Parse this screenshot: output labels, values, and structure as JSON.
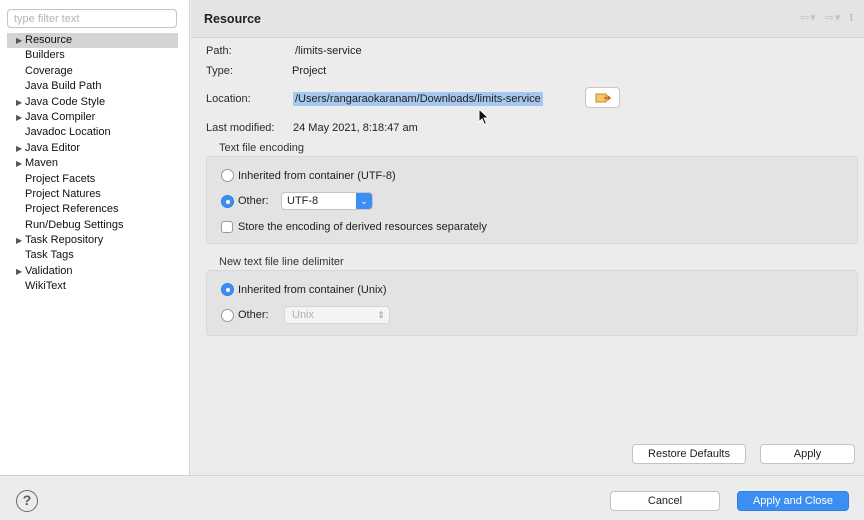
{
  "sidebar": {
    "filter_placeholder": "type filter text",
    "items": [
      {
        "label": "Resource",
        "expandable": true,
        "selected": true
      },
      {
        "label": "Builders",
        "expandable": false
      },
      {
        "label": "Coverage",
        "expandable": false
      },
      {
        "label": "Java Build Path",
        "expandable": false
      },
      {
        "label": "Java Code Style",
        "expandable": true
      },
      {
        "label": "Java Compiler",
        "expandable": true
      },
      {
        "label": "Javadoc Location",
        "expandable": false
      },
      {
        "label": "Java Editor",
        "expandable": true
      },
      {
        "label": "Maven",
        "expandable": true
      },
      {
        "label": "Project Facets",
        "expandable": false
      },
      {
        "label": "Project Natures",
        "expandable": false
      },
      {
        "label": "Project References",
        "expandable": false
      },
      {
        "label": "Run/Debug Settings",
        "expandable": false
      },
      {
        "label": "Task Repository",
        "expandable": true
      },
      {
        "label": "Task Tags",
        "expandable": false
      },
      {
        "label": "Validation",
        "expandable": true
      },
      {
        "label": "WikiText",
        "expandable": false
      }
    ]
  },
  "header": {
    "title": "Resource"
  },
  "info": {
    "path_label": "Path:",
    "path_value": "/limits-service",
    "type_label": "Type:",
    "type_value": "Project",
    "location_label": "Location:",
    "location_value": "/Users/rangaraokaranam/Downloads/limits-service",
    "modified_label": "Last modified:",
    "modified_value": "24 May 2021, 8:18:47 am"
  },
  "encoding": {
    "group_title": "Text file encoding",
    "inherited_label": "Inherited from container (UTF-8)",
    "other_label": "Other:",
    "other_value": "UTF-8",
    "selected": "other",
    "store_label": "Store the encoding of derived resources separately",
    "store_checked": false
  },
  "delimiter": {
    "group_title": "New text file line delimiter",
    "inherited_label": "Inherited from container (Unix)",
    "other_label": "Other:",
    "other_value": "Unix",
    "selected": "inherited"
  },
  "buttons": {
    "restore_defaults": "Restore Defaults",
    "apply": "Apply",
    "cancel": "Cancel",
    "apply_close": "Apply and Close",
    "help": "?"
  },
  "colors": {
    "accent": "#3b8ff3",
    "selection": "#a6c8ef"
  }
}
